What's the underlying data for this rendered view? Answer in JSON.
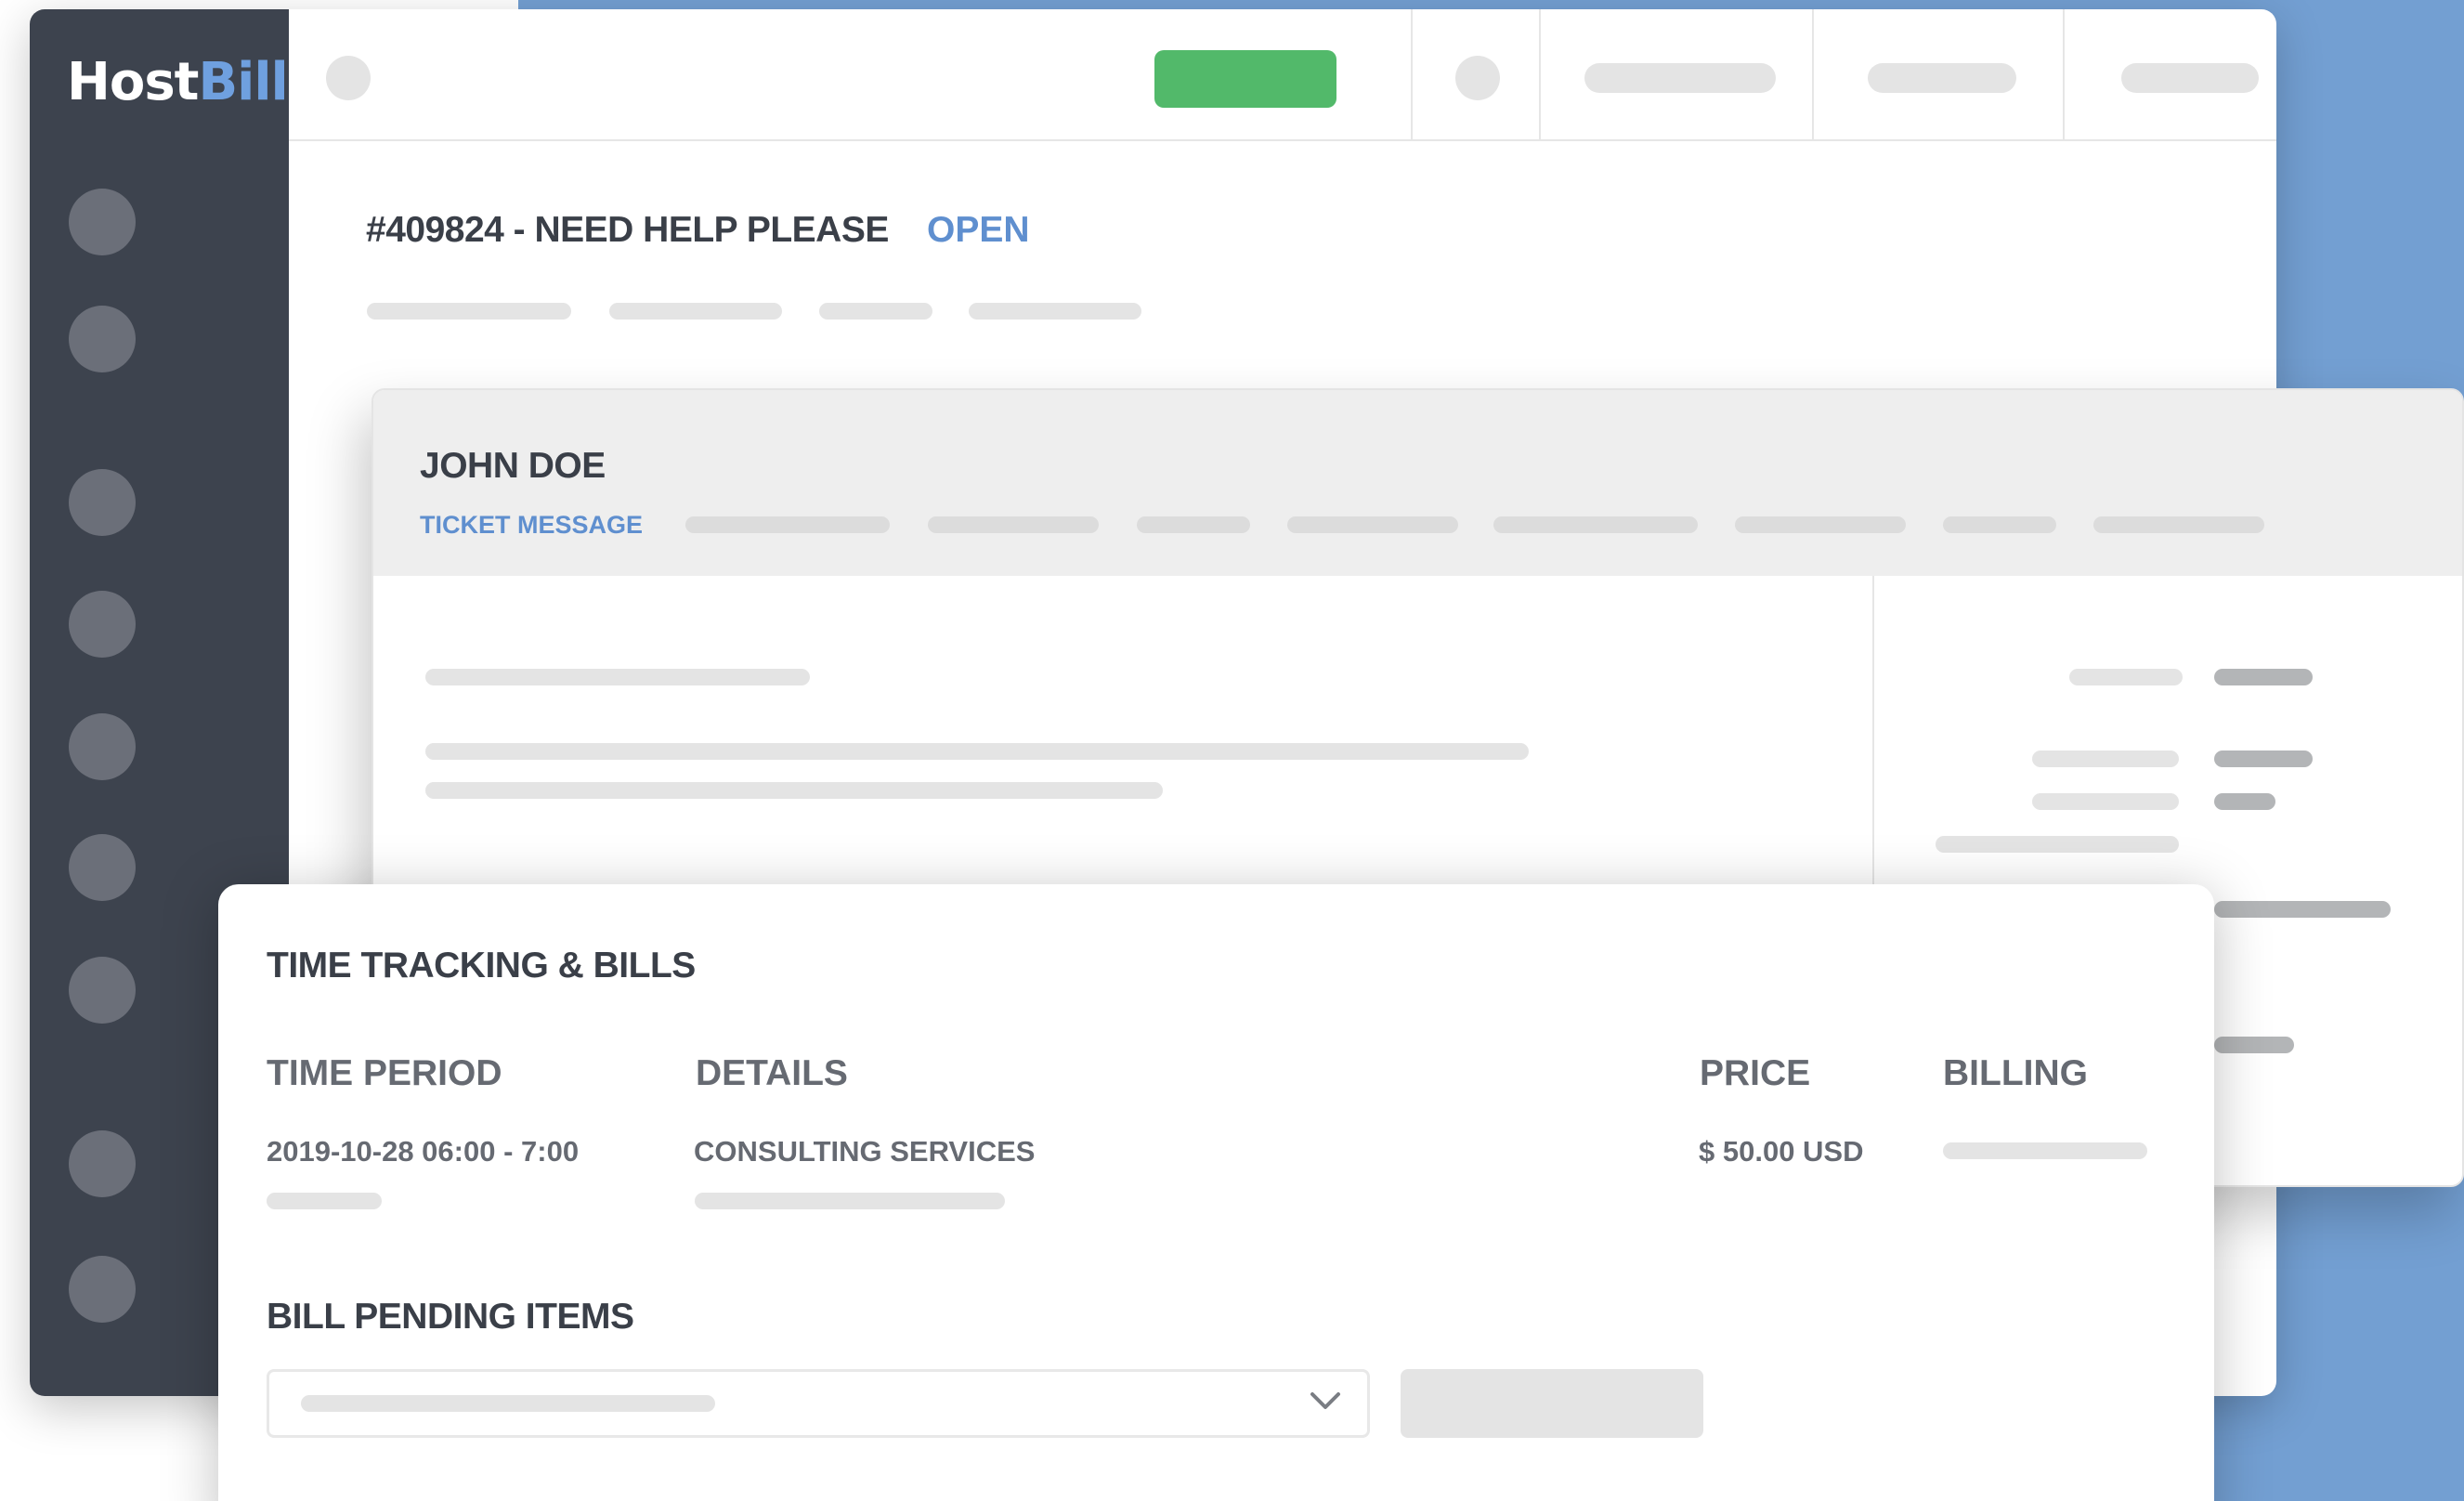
{
  "app": {
    "logo": {
      "part1": "Host",
      "part2": "Bill"
    }
  },
  "ticket": {
    "title": "#409824 - NEED HELP PLEASE",
    "status": "OPEN"
  },
  "message": {
    "author": "JOHN DOE",
    "tab_label": "TICKET MESSAGE"
  },
  "time_tracking": {
    "title": "TIME TRACKING & BILLS",
    "columns": [
      "TIME PERIOD",
      "DETAILS",
      "PRICE",
      "BILLING"
    ],
    "rows": [
      {
        "time_period": "2019-10-28 06:00 - 7:00",
        "details": "CONSULTING SERVICES",
        "price": "$ 50.00 USD"
      }
    ],
    "bill_pending_label": "BILL PENDING ITEMS"
  },
  "colors": {
    "background_blue": "#739fd2",
    "sidebar": "#3d434e",
    "nav_dot": "#6b6f79",
    "logo_host": "#ffffff",
    "logo_bill": "#6fa0df",
    "accent_blue": "#5f8fcf",
    "green_button": "#52b96a",
    "text_dark": "#3a3f48",
    "text_mid": "#666a72",
    "placeholder_light": "#e4e4e4",
    "placeholder_mid": "#b3b5b7",
    "header_gray": "#eeeeee"
  },
  "icons": [
    "chevron-down-icon",
    "nav-dot-icon",
    "avatar-icon",
    "notification-icon"
  ]
}
